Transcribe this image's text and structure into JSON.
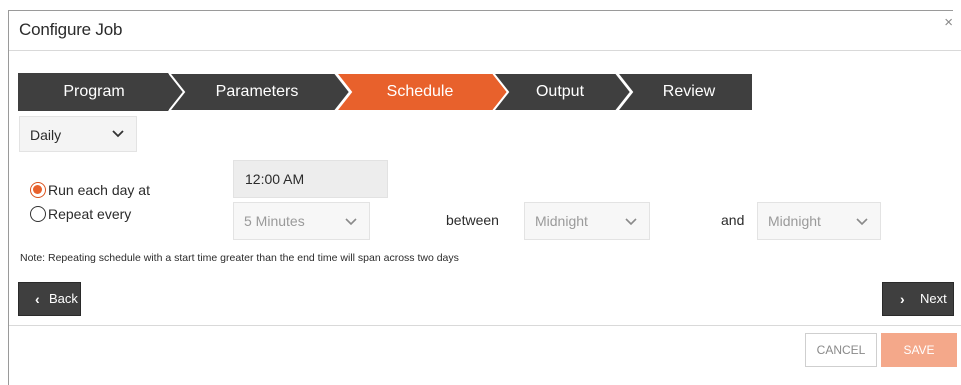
{
  "dialog": {
    "title": "Configure Job",
    "close_glyph": "×"
  },
  "wizard": {
    "steps": [
      {
        "label": "Program",
        "active": false
      },
      {
        "label": "Parameters",
        "active": false
      },
      {
        "label": "Schedule",
        "active": true
      },
      {
        "label": "Output",
        "active": false
      },
      {
        "label": "Review",
        "active": false
      }
    ],
    "colors": {
      "inactive": "#3f3f3f",
      "active": "#e8612c"
    }
  },
  "frequency": {
    "value": "Daily",
    "icon": "chevron-down-icon"
  },
  "schedule": {
    "run_each_day_label": "Run each day at",
    "run_each_day_selected": true,
    "run_time_value": "12:00 AM",
    "repeat_every_label": "Repeat every",
    "repeat_every_selected": false,
    "repeat_interval_value": "5 Minutes",
    "between_label": "between",
    "between_start_value": "Midnight",
    "and_label": "and",
    "between_end_value": "Midnight"
  },
  "note": "Note: Repeating schedule with a start time greater than the end time will span across two days",
  "nav": {
    "back_label": "Back",
    "back_glyph": "‹",
    "next_label": "Next",
    "next_glyph": "›"
  },
  "footer": {
    "cancel_label": "CANCEL",
    "save_label": "SAVE",
    "save_color": "#f4a88a"
  }
}
